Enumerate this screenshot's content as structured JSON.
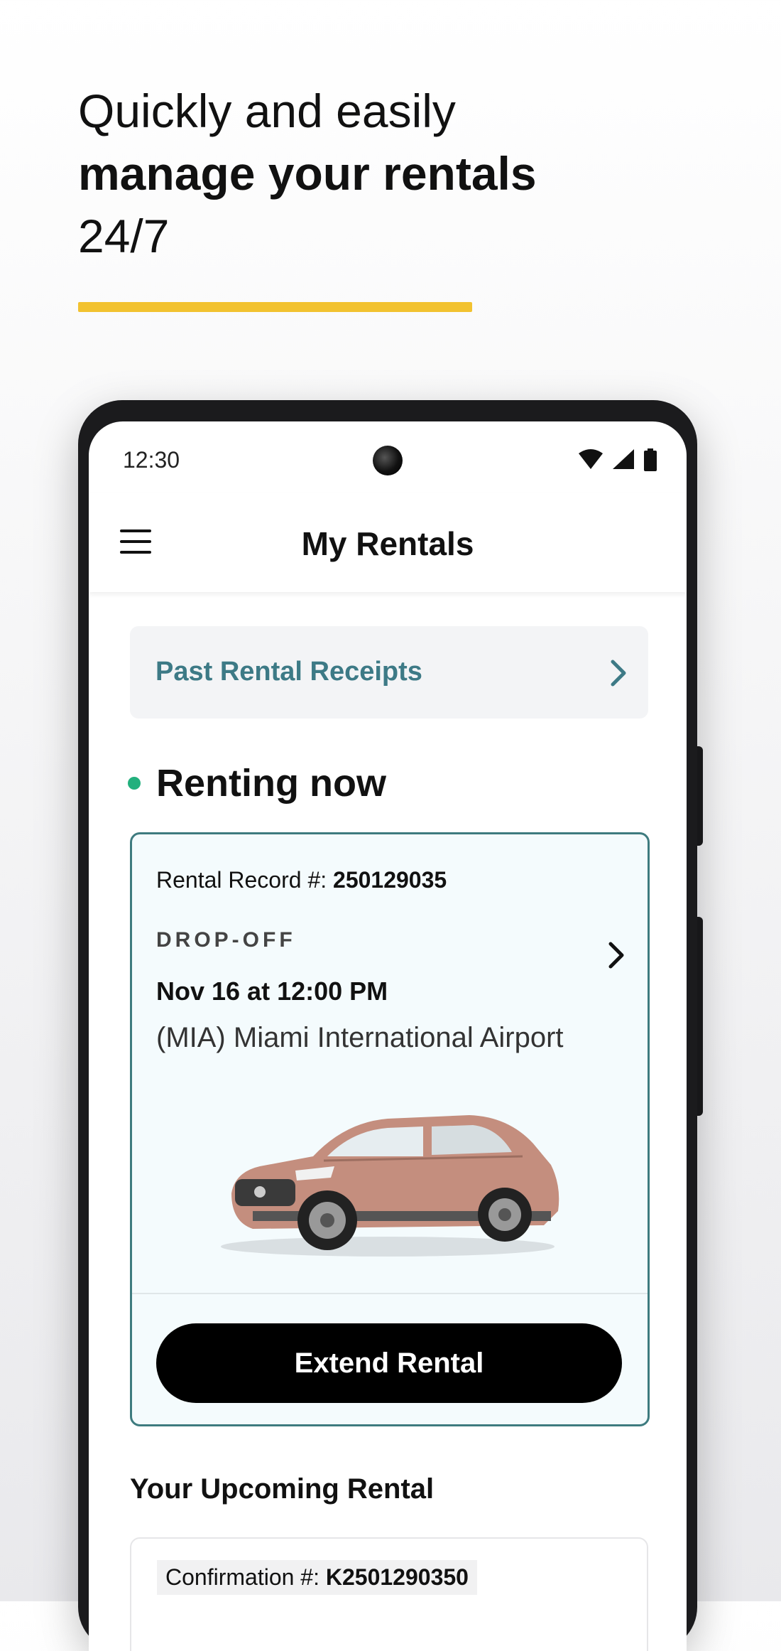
{
  "headline": {
    "line1": "Quickly and easily",
    "line2": "manage your rentals",
    "line3": "24/7"
  },
  "colors": {
    "accent": "#f2c230",
    "teal": "#3d7a86",
    "green_dot": "#22b07d"
  },
  "status_bar": {
    "time": "12:30",
    "icons": [
      "wifi-icon",
      "signal-icon",
      "battery-icon"
    ]
  },
  "app_bar": {
    "menu_icon": "hamburger-menu-icon",
    "title": "My Rentals"
  },
  "past_receipts": {
    "label": "Past Rental Receipts",
    "icon": "chevron-right-icon"
  },
  "renting_now": {
    "label": "Renting now",
    "record_label": "Rental Record #:",
    "record_number": "250129035",
    "dropoff_label": "DROP-OFF",
    "dropoff_datetime": "Nov 16 at 12:00 PM",
    "dropoff_location": "(MIA) Miami International Airport",
    "extend_button": "Extend Rental"
  },
  "upcoming": {
    "title": "Your Upcoming Rental",
    "confirmation_label": "Confirmation #:",
    "confirmation_number": "K2501290350"
  }
}
